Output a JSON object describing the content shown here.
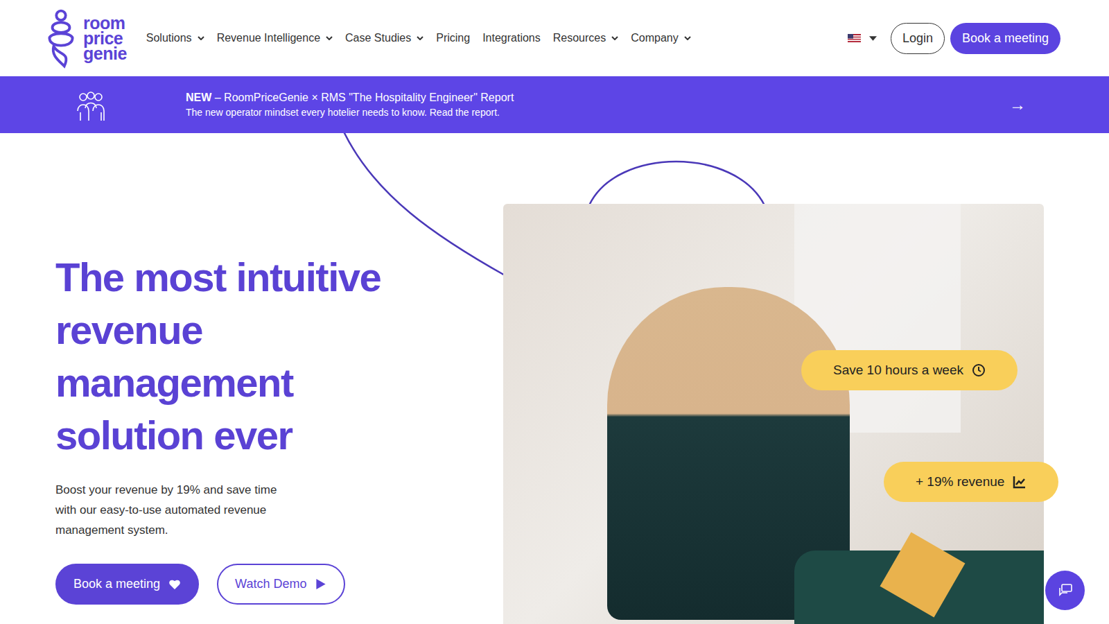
{
  "logo": {
    "lines": [
      "room",
      "price",
      "genie"
    ]
  },
  "nav": [
    {
      "label": "Solutions",
      "dropdown": true
    },
    {
      "label": "Revenue Intelligence",
      "dropdown": true
    },
    {
      "label": "Case Studies",
      "dropdown": true
    },
    {
      "label": "Pricing",
      "dropdown": false
    },
    {
      "label": "Integrations",
      "dropdown": false
    },
    {
      "label": "Resources",
      "dropdown": true
    },
    {
      "label": "Company",
      "dropdown": true
    }
  ],
  "header_buttons": {
    "login": "Login",
    "cta": "Book a meeting"
  },
  "announcement": {
    "badge": "NEW",
    "title": " – RoomPriceGenie × RMS \"The Hospitality Engineer\" Report",
    "subtitle": "The new operator mindset every hotelier needs to know. Read the report.",
    "arrow": "→"
  },
  "hero": {
    "heading_lines": [
      "The most intuitive",
      "revenue",
      "management",
      "solution ever"
    ],
    "text": "Boost your revenue by 19% and save time with our easy-to-use automated revenue management system.",
    "buttons": [
      {
        "label": "Book a meeting",
        "kind": "primary"
      },
      {
        "label": "Watch Demo",
        "kind": "outline"
      }
    ]
  },
  "badges": [
    {
      "label": "Save 10 hours a week",
      "kind": "clock"
    },
    {
      "label": "+ 19% revenue",
      "kind": "chart"
    }
  ]
}
